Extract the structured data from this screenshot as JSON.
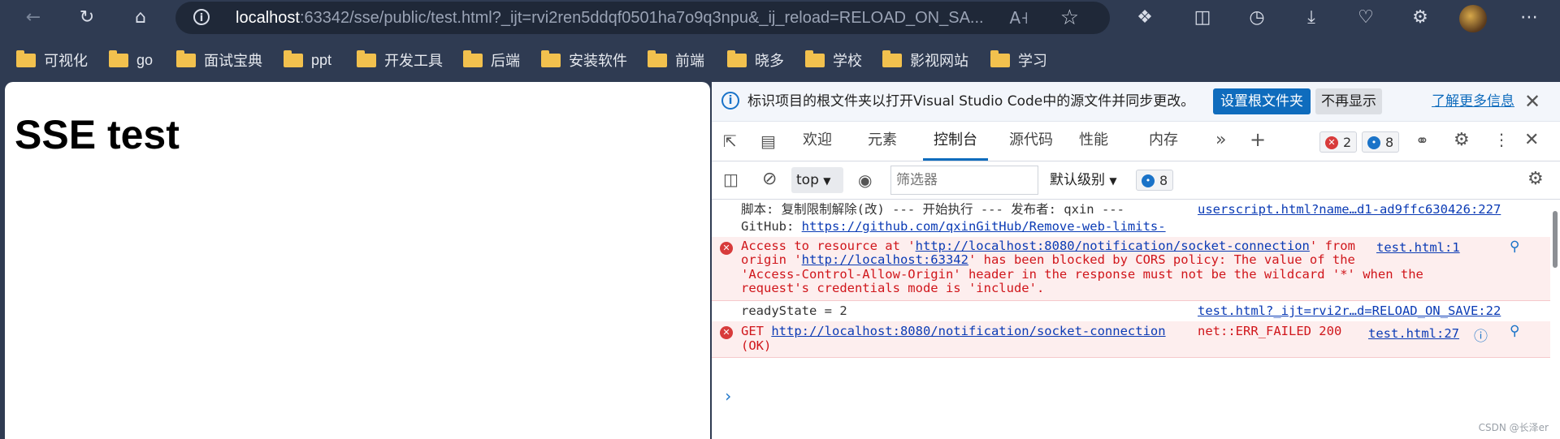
{
  "browser": {
    "address": {
      "host": "localhost",
      "rest": ":63342/sse/public/test.html?_ijt=rvi2ren5ddqf0501ha7o9q3npu&_ij_reload=RELOAD_ON_SA..."
    },
    "bookmarks": [
      "可视化",
      "go",
      "面试宝典",
      "ppt",
      "开发工具",
      "后端",
      "安装软件",
      "前端",
      "晓多",
      "学校",
      "影视网站",
      "学习"
    ]
  },
  "page": {
    "heading": "SSE test"
  },
  "devtools": {
    "infobar": {
      "message": "标识项目的根文件夹以打开Visual Studio Code中的源文件并同步更改。",
      "primary_button": "设置根文件夹",
      "secondary_button": "不再显示",
      "learn_more": "了解更多信息"
    },
    "tabs": [
      "欢迎",
      "元素",
      "控制台",
      "源代码",
      "性能",
      "内存"
    ],
    "active_tab": "控制台",
    "error_count": "2",
    "message_count": "8",
    "console_toolbar": {
      "context": "top",
      "filter_placeholder": "筛选器",
      "levels": "默认级别",
      "message_count": "8"
    },
    "console": {
      "row1": {
        "line1": "脚本: 复制限制解除(改) --- 开始执行 --- 发布者: qxin ---",
        "line2_prefix": "GitHub: ",
        "line2_link": "https://github.com/qxinGitHub/Remove-web-limits-",
        "source": "userscript.html?name…d1-ad9ffc630426:227"
      },
      "row2": {
        "l1_a": "Access to resource at '",
        "l1_link": "http://localhost:8080/notification/socket-connection",
        "l1_b": "' from",
        "l2_a": "origin '",
        "l2_link": "http://localhost:63342",
        "l2_b": "' has been blocked by CORS policy: The value of the",
        "l3": "'Access-Control-Allow-Origin' header in the response must not be the wildcard '*' when the",
        "l4": "request's credentials mode is 'include'.",
        "source": "test.html:1"
      },
      "row3": {
        "text": "readyState = 2",
        "source": "test.html?_ijt=rvi2r…d=RELOAD_ON_SAVE:22"
      },
      "row4": {
        "method": "GET ",
        "link": "http://localhost:8080/notification/socket-connection",
        "status": "net::ERR_FAILED 200",
        "line2": "(OK)",
        "source": "test.html:27"
      }
    }
  },
  "watermark": "CSDN @长泽er"
}
